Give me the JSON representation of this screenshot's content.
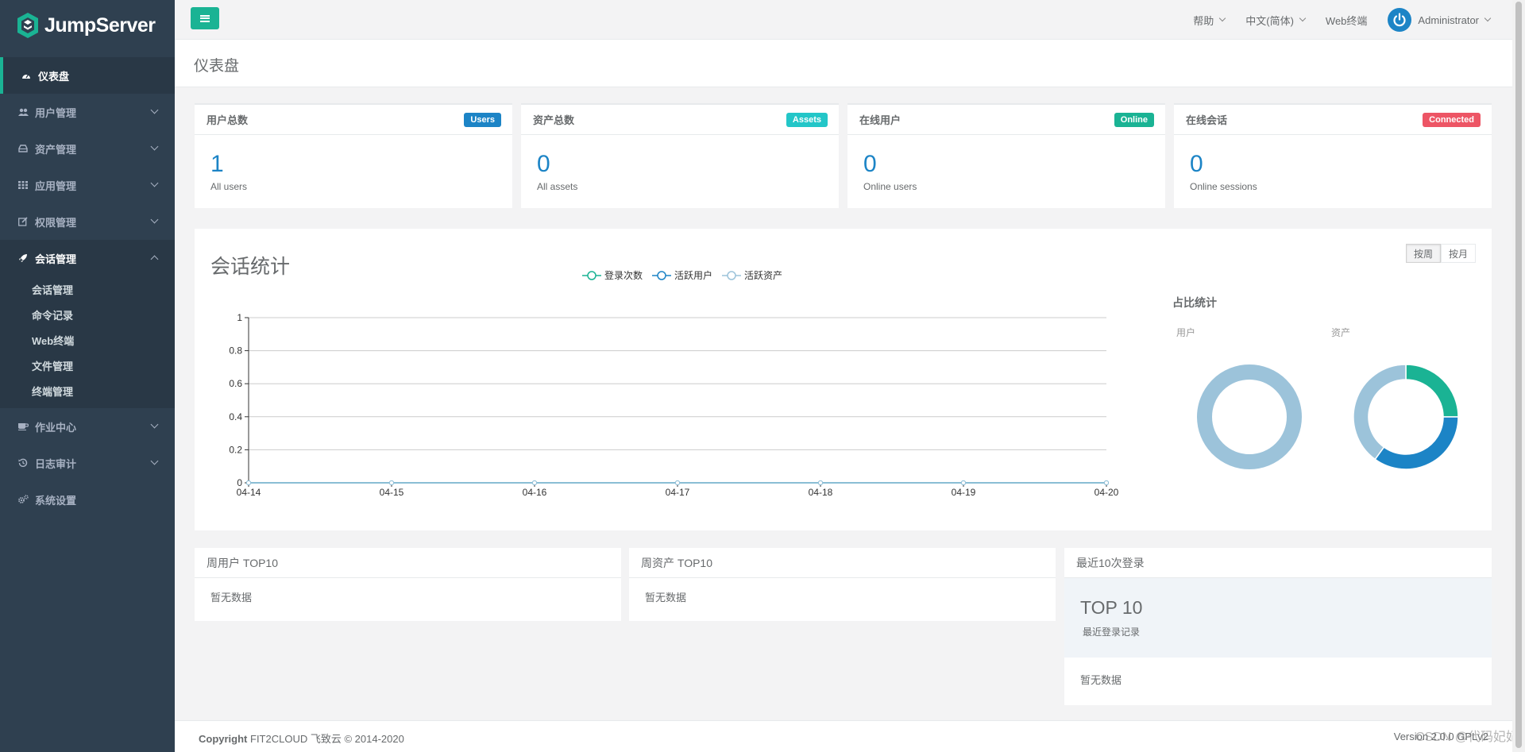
{
  "brand": {
    "name": "JumpServer"
  },
  "sidebar": {
    "items": [
      {
        "label": "仪表盘",
        "icon": "dashboard-icon",
        "active": true
      },
      {
        "label": "用户管理",
        "icon": "users-icon"
      },
      {
        "label": "资产管理",
        "icon": "inbox-icon"
      },
      {
        "label": "应用管理",
        "icon": "grid-icon"
      },
      {
        "label": "权限管理",
        "icon": "edit-icon"
      },
      {
        "label": "会话管理",
        "icon": "rocket-icon",
        "open": true
      },
      {
        "label": "作业中心",
        "icon": "coffee-icon"
      },
      {
        "label": "日志审计",
        "icon": "history-icon"
      },
      {
        "label": "系统设置",
        "icon": "gears-icon"
      }
    ],
    "session_sub": [
      "会话管理",
      "命令记录",
      "Web终端",
      "文件管理",
      "终端管理"
    ]
  },
  "topbar": {
    "help": "帮助",
    "language": "中文(简体)",
    "web_terminal": "Web终端",
    "user": "Administrator"
  },
  "page": {
    "title": "仪表盘"
  },
  "stats": [
    {
      "title": "用户总数",
      "badge": "Users",
      "badge_color": "#1c84c6",
      "value": "1",
      "sub": "All users"
    },
    {
      "title": "资产总数",
      "badge": "Assets",
      "badge_color": "#23c6c8",
      "value": "0",
      "sub": "All assets"
    },
    {
      "title": "在线用户",
      "badge": "Online",
      "badge_color": "#1ab394",
      "value": "0",
      "sub": "Online users"
    },
    {
      "title": "在线会话",
      "badge": "Connected",
      "badge_color": "#ed5565",
      "value": "0",
      "sub": "Online sessions"
    }
  ],
  "session_chart": {
    "title": "会话统计",
    "range_week": "按周",
    "range_month": "按月",
    "ratio_title": "占比统计",
    "ratio_users_label": "用户",
    "ratio_assets_label": "资产"
  },
  "chart_data": [
    {
      "type": "line",
      "x": [
        "04-14",
        "04-15",
        "04-16",
        "04-17",
        "04-18",
        "04-19",
        "04-20"
      ],
      "ylim": [
        0,
        1
      ],
      "yticks": [
        "0",
        "0.2",
        "0.4",
        "0.6",
        "0.8",
        "1"
      ],
      "series": [
        {
          "name": "登录次数",
          "color": "#1ab394",
          "values": [
            0,
            0,
            0,
            0,
            0,
            0,
            0
          ]
        },
        {
          "name": "活跃用户",
          "color": "#1c84c6",
          "values": [
            0,
            0,
            0,
            0,
            0,
            0,
            0
          ]
        },
        {
          "name": "活跃资产",
          "color": "#9cc3da",
          "values": [
            0,
            0,
            0,
            0,
            0,
            0,
            0
          ]
        }
      ]
    },
    {
      "type": "pie",
      "title": "用户",
      "values": [
        1
      ],
      "colors": [
        "#9cc3da"
      ]
    },
    {
      "type": "pie",
      "title": "资产",
      "values": [
        0.25,
        0.35,
        0.4
      ],
      "colors": [
        "#1ab394",
        "#1c84c6",
        "#9cc3da"
      ]
    }
  ],
  "bottom": {
    "week_users_title": "周用户 TOP10",
    "week_assets_title": "周资产 TOP10",
    "recent_login_title": "最近10次登录",
    "no_data": "暂无数据",
    "top10_big": "TOP 10",
    "top10_sub": "最近登录记录"
  },
  "footer": {
    "copyright_label": "Copyright",
    "copyright_text": " FIT2CLOUD 飞致云 © 2014-2020",
    "version": "Version 2.0.0 GPLv2",
    "watermark": "CSDN @代码妃妃"
  }
}
